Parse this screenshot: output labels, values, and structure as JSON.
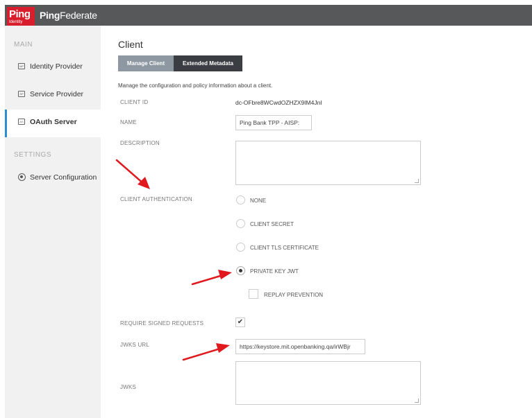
{
  "app": {
    "logo_ping": "Ping",
    "logo_identity": "Identity",
    "product_bold": "Ping",
    "product_light": "Federate"
  },
  "sidebar": {
    "main_heading": "MAIN",
    "settings_heading": "SETTINGS",
    "items": [
      {
        "label": "Identity Provider",
        "icon": "IdP"
      },
      {
        "label": "Service Provider",
        "icon": "SP"
      },
      {
        "label": "OAuth Server",
        "icon": "AS"
      },
      {
        "label": "Server Configuration",
        "icon": "gear"
      }
    ]
  },
  "page": {
    "title": "Client",
    "tabs": [
      "Manage Client",
      "Extended Metadata"
    ],
    "description": "Manage the configuration and policy information about a client."
  },
  "form": {
    "client_id_label": "CLIENT ID",
    "client_id_value": "dc-OFbre8WCwdOZHZX9IM4Jnl",
    "name_label": "NAME",
    "name_value": "Ping Bank TPP - AISP:",
    "description_label": "DESCRIPTION",
    "client_auth_label": "CLIENT AUTHENTICATION",
    "auth_options": [
      "NONE",
      "CLIENT SECRET",
      "CLIENT TLS CERTIFICATE",
      "PRIVATE KEY JWT"
    ],
    "auth_selected": "PRIVATE KEY JWT",
    "replay_prevention_label": "REPLAY PREVENTION",
    "replay_prevention_checked": false,
    "require_signed_label": "REQUIRE SIGNED REQUESTS",
    "require_signed_checked": true,
    "jwks_url_label": "JWKS URL",
    "jwks_url_value": "https://keystore.mit.openbanking.qa/irWBjr",
    "jwks_label": "JWKS"
  },
  "colors": {
    "brand_red": "#d81e2c",
    "topbar": "#57585a",
    "active_tab": "#8d98a2",
    "dark_tab": "#3a3d41",
    "accent_blue": "#2a8fce",
    "annotation_arrow": "#e0191f"
  }
}
